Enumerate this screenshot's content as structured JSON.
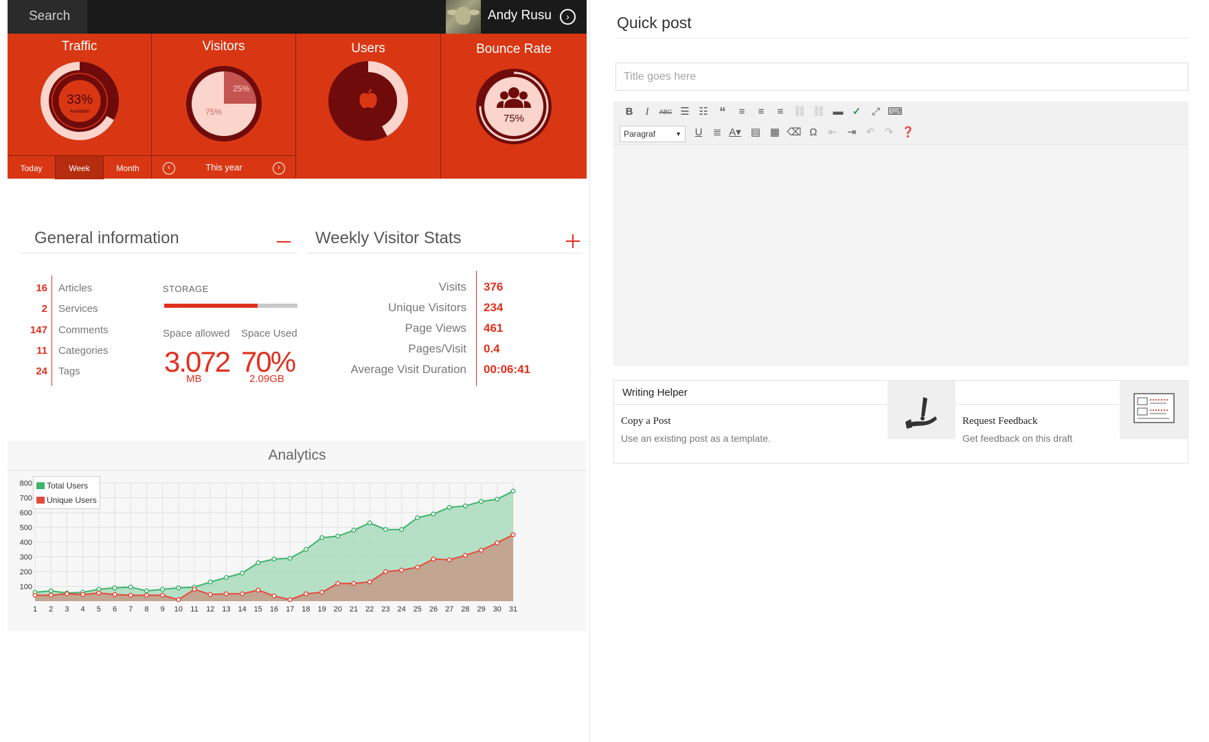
{
  "topbar": {
    "search_label": "Search",
    "user_name": "Andy Rusu"
  },
  "tiles": {
    "traffic": {
      "title": "Traffic",
      "percent": "33%",
      "sub": "Available",
      "value_fraction": 0.33
    },
    "visitors": {
      "title": "Visitors",
      "slice_small": "25%",
      "slice_large": "75%"
    },
    "users": {
      "title": "Users",
      "icon": "apple-icon",
      "value_fraction": 0.42
    },
    "bounce": {
      "title": "Bounce Rate",
      "icon": "users-group-icon",
      "percent": "75%",
      "value_fraction": 0.75
    }
  },
  "traffic_tabs": [
    {
      "label": "Today",
      "active": false
    },
    {
      "label": "Week",
      "active": true
    },
    {
      "label": "Month",
      "active": false
    }
  ],
  "visitors_nav": {
    "label": "This year"
  },
  "general_info": {
    "title": "General information",
    "rows": [
      {
        "num": "16",
        "label": "Articles"
      },
      {
        "num": "2",
        "label": "Services"
      },
      {
        "num": "147",
        "label": "Comments"
      },
      {
        "num": "11",
        "label": "Categories"
      },
      {
        "num": "24",
        "label": "Tags"
      }
    ],
    "storage": {
      "label": "STORAGE",
      "used_fraction": 0.7,
      "allowed_label": "Space allowed",
      "used_label": "Space Used",
      "allowed_value": "3.072",
      "allowed_unit": "MB",
      "used_value": "70%",
      "used_unit": "2.09GB"
    }
  },
  "weekly_stats": {
    "title": "Weekly Visitor Stats",
    "rows": [
      {
        "label": "Visits",
        "value": "376"
      },
      {
        "label": "Unique Visitors",
        "value": "234"
      },
      {
        "label": "Page Views",
        "value": "461"
      },
      {
        "label": "Pages/Visit",
        "value": "0.4"
      },
      {
        "label": "Average Visit Duration",
        "value": "00:06:41"
      }
    ]
  },
  "analytics": {
    "title": "Analytics"
  },
  "chart_data": {
    "type": "area",
    "x": [
      1,
      2,
      3,
      4,
      5,
      6,
      7,
      8,
      9,
      10,
      11,
      12,
      13,
      14,
      15,
      16,
      17,
      18,
      19,
      20,
      21,
      22,
      23,
      24,
      25,
      26,
      27,
      28,
      29,
      30,
      31
    ],
    "ylim": [
      0,
      800
    ],
    "yticks": [
      100,
      200,
      300,
      400,
      500,
      600,
      700,
      800
    ],
    "grid": true,
    "legend_position": "top-left",
    "series": [
      {
        "name": "Total Users",
        "color": "#3fb36b",
        "fill": "#a9dcbc",
        "values": [
          60,
          70,
          55,
          60,
          80,
          90,
          95,
          70,
          80,
          90,
          95,
          130,
          160,
          190,
          260,
          285,
          290,
          350,
          430,
          440,
          480,
          530,
          485,
          485,
          565,
          590,
          635,
          645,
          675,
          690,
          745
        ]
      },
      {
        "name": "Unique Users",
        "color": "#e34a3c",
        "fill": "#c49b88",
        "values": [
          40,
          40,
          50,
          45,
          55,
          45,
          40,
          40,
          40,
          10,
          80,
          45,
          50,
          50,
          75,
          35,
          10,
          50,
          60,
          120,
          120,
          130,
          200,
          210,
          230,
          285,
          280,
          310,
          345,
          395,
          450
        ]
      }
    ]
  },
  "quick_post": {
    "title": "Quick post",
    "title_placeholder": "Title goes here",
    "format_value": "Paragraf"
  },
  "toolbar_icons": {
    "row1": [
      "bold-icon",
      "italic-icon",
      "strikethrough-icon",
      "bullet-list-icon",
      "numbered-list-icon",
      "blockquote-icon",
      "align-left-icon",
      "align-center-icon",
      "align-right-icon",
      "link-icon",
      "unlink-icon",
      "read-more-icon",
      "spellcheck-icon",
      "fullscreen-icon",
      "kitchen-sink-icon"
    ],
    "row2": [
      "underline-icon",
      "justify-icon",
      "text-color-icon",
      "paste-text-icon",
      "paste-word-icon",
      "clear-formatting-icon",
      "special-char-icon",
      "outdent-icon",
      "indent-icon",
      "undo-icon",
      "redo-icon",
      "help-icon"
    ]
  },
  "writing_helper": {
    "title": "Writing Helper",
    "cards": [
      {
        "title": "Copy a Post",
        "desc": "Use an existing post as a template.",
        "icon": "pen-hand-icon"
      },
      {
        "title": "Request Feedback",
        "desc": "Get feedback on this draft",
        "icon": "document-feedback-icon"
      }
    ]
  },
  "colors": {
    "accent": "#e0301e",
    "tile_bg": "#d93714",
    "donut_dark": "#6f0b0b",
    "donut_light": "#fbd4cc"
  }
}
